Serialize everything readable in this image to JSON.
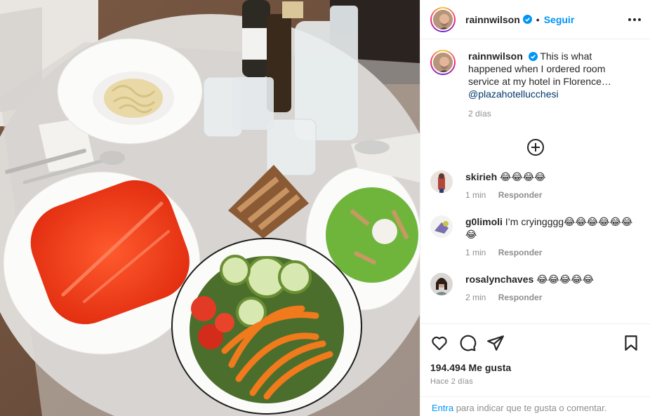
{
  "post": {
    "photo_alt": "Room service meal on a table: pasta, an empty red plate with cutlery, bread, green soup, and salad"
  },
  "header": {
    "username": "rainnwilson",
    "separator": "•",
    "follow_label": "Seguir"
  },
  "caption": {
    "username": "rainnwilson",
    "text": "This is what happened when I ordered room service at my hotel in Florence…",
    "mention": "@plazahotellucchesi",
    "time": "2 días"
  },
  "comments": [
    {
      "username": "skirieh",
      "text": "😂😂😂😂",
      "time": "1 min",
      "reply": "Responder"
    },
    {
      "username": "g0limoli",
      "text": "I’m cryingggg😂😂😂😂😂😂😂",
      "time": "1 min",
      "reply": "Responder"
    },
    {
      "username": "rosalynchaves",
      "text": "😂😂😂😂😂",
      "time": "2 min",
      "reply": "Responder"
    }
  ],
  "stats": {
    "likes": "194.494 Me gusta",
    "posted": "Hace 2 días"
  },
  "login": {
    "link": "Entra",
    "text": "para indicar que te gusta o comentar."
  },
  "colors": {
    "accent": "#0095f6",
    "verified": "#0095f6",
    "meta": "#8e8e8e"
  },
  "icons": [
    "more-icon",
    "verified-icon",
    "add-comments-icon",
    "heart-icon",
    "comment-icon",
    "share-icon",
    "save-icon"
  ]
}
